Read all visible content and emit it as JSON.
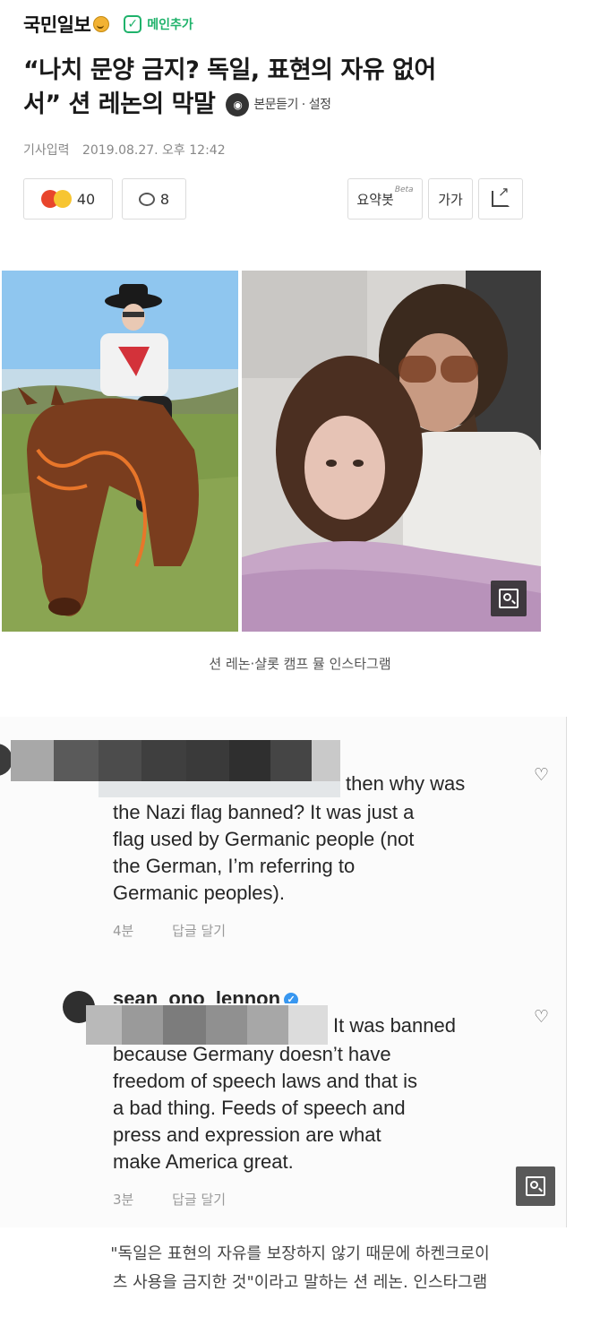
{
  "header": {
    "logo": "국민일보",
    "main_add_label": "메인추가",
    "main_add_check": "✓"
  },
  "article": {
    "title_line1": "“나치 문양 금지? 독일, 표현의 자유 없어",
    "title_line2": "서” 션 레논의 막말",
    "listen_label": "본문듣기 · 설정",
    "date_label": "기사입력",
    "date_value": "2019.08.27. 오후 12:42"
  },
  "actions": {
    "reaction_count": "40",
    "comment_count": "8",
    "summary_label": "요약봇",
    "summary_beta": "Beta",
    "font_label": "가가",
    "share_icon": "share-icon"
  },
  "photo": {
    "caption": "션 레논·샬롯 캠프 뮬 인스타그램"
  },
  "comments": [
    {
      "lines": [
        "then why was",
        "the Nazi flag banned? It was just a",
        "flag used by Germanic people (not",
        "the German, I’m referring to",
        "Germanic peoples)."
      ],
      "time": "4분",
      "reply": "답글 달기"
    },
    {
      "username": "sean_ono_lennon",
      "lines": [
        "It was banned",
        "because Germany doesn’t have",
        "freedom of speech laws and that is",
        "a bad thing. Feeds of speech and",
        "press and expression are what",
        "make America great."
      ],
      "time": "3분",
      "reply": "답글 달기"
    }
  ],
  "caption2": {
    "line1": "\"독일은 표현의 자유를 보장하지 않기 때문에 하켄크로이",
    "line2": "츠 사용을 금지한 것\"이라고 말하는 션 레논. 인스타그램"
  },
  "colors": {
    "accent_green": "#1fb26b",
    "verified_blue": "#3897f0"
  }
}
